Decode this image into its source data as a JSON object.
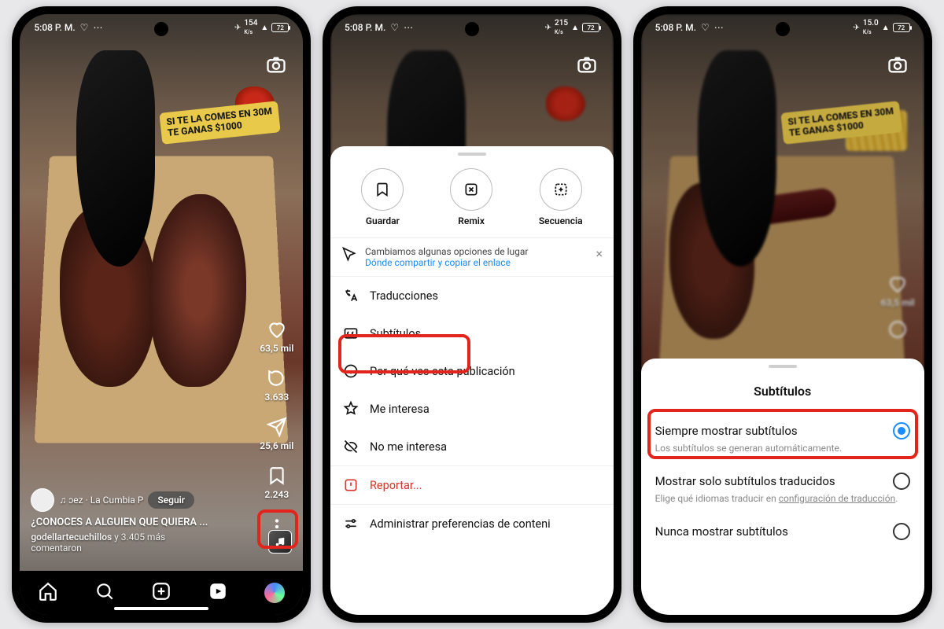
{
  "statusbar": {
    "time": "5:08 P. M.",
    "net_speed_1": "154",
    "net_speed_2": "215",
    "net_speed_3": "15.0",
    "net_unit": "K/s",
    "battery": "72"
  },
  "reel": {
    "sticker_line1": "SI TE LA COMES EN 30M",
    "sticker_line2": "TE GANAS $1000",
    "likes": "63,5 mil",
    "comments": "3.633",
    "shares": "25,6 mil",
    "saves": "2.243",
    "follow_label": "Seguir",
    "music": "♫ ɔez · La Cumbia   P",
    "title": "¿CONOCES A ALGUIEN QUE QUIERA ...",
    "comment_user": "godellartecuchillos",
    "comment_and": "y 3.405 más",
    "comment_verb": "comentaron"
  },
  "reel3": {
    "likes": "63,5 mil"
  },
  "sheet_menu": {
    "action_save": "Guardar",
    "action_remix": "Remix",
    "action_sequence": "Secuencia",
    "notice_text": "Cambiamos algunas opciones de lugar",
    "notice_link": "Dónde compartir y copiar el enlace",
    "item_translations": "Traducciones",
    "item_subtitles": "Subtítulos",
    "item_why": "Por qué ves esta publicación",
    "item_interested": "Me interesa",
    "item_not_interested": "No me interesa",
    "item_report": "Reportar...",
    "item_manage": "Administrar preferencias de conteni"
  },
  "sheet_sub": {
    "title": "Subtítulos",
    "opt1_label": "Siempre mostrar subtítulos",
    "opt1_desc": "Los subtítulos se generan automáticamente.",
    "opt2_label": "Mostrar solo subtítulos traducidos",
    "opt2_desc_a": "Elige qué idiomas traducir en ",
    "opt2_desc_link": "configuración de traducción",
    "opt3_label": "Nunca mostrar subtítulos"
  }
}
